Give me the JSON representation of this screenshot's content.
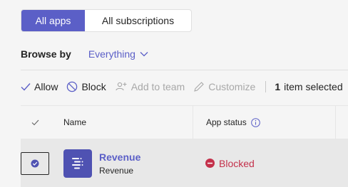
{
  "tabs": [
    {
      "label": "All apps",
      "active": true
    },
    {
      "label": "All subscriptions",
      "active": false
    }
  ],
  "browse": {
    "label": "Browse by",
    "value": "Everything"
  },
  "toolbar": {
    "allow": "Allow",
    "block": "Block",
    "add_to_team": "Add to team",
    "customize": "Customize",
    "selected_count": "1",
    "selected_suffix": "item selected"
  },
  "table": {
    "columns": {
      "name": "Name",
      "status": "App status"
    },
    "rows": [
      {
        "title": "Revenue",
        "subtitle": "Revenue",
        "status": "Blocked",
        "selected": true
      }
    ]
  },
  "colors": {
    "accent": "#5b5fc7",
    "blocked": "#c4314b"
  },
  "icons": [
    "checkmark-icon",
    "block-icon",
    "add-to-team-icon",
    "pencil-icon",
    "info-icon",
    "chevron-down-icon",
    "revenue-app-icon",
    "blocked-status-icon"
  ]
}
